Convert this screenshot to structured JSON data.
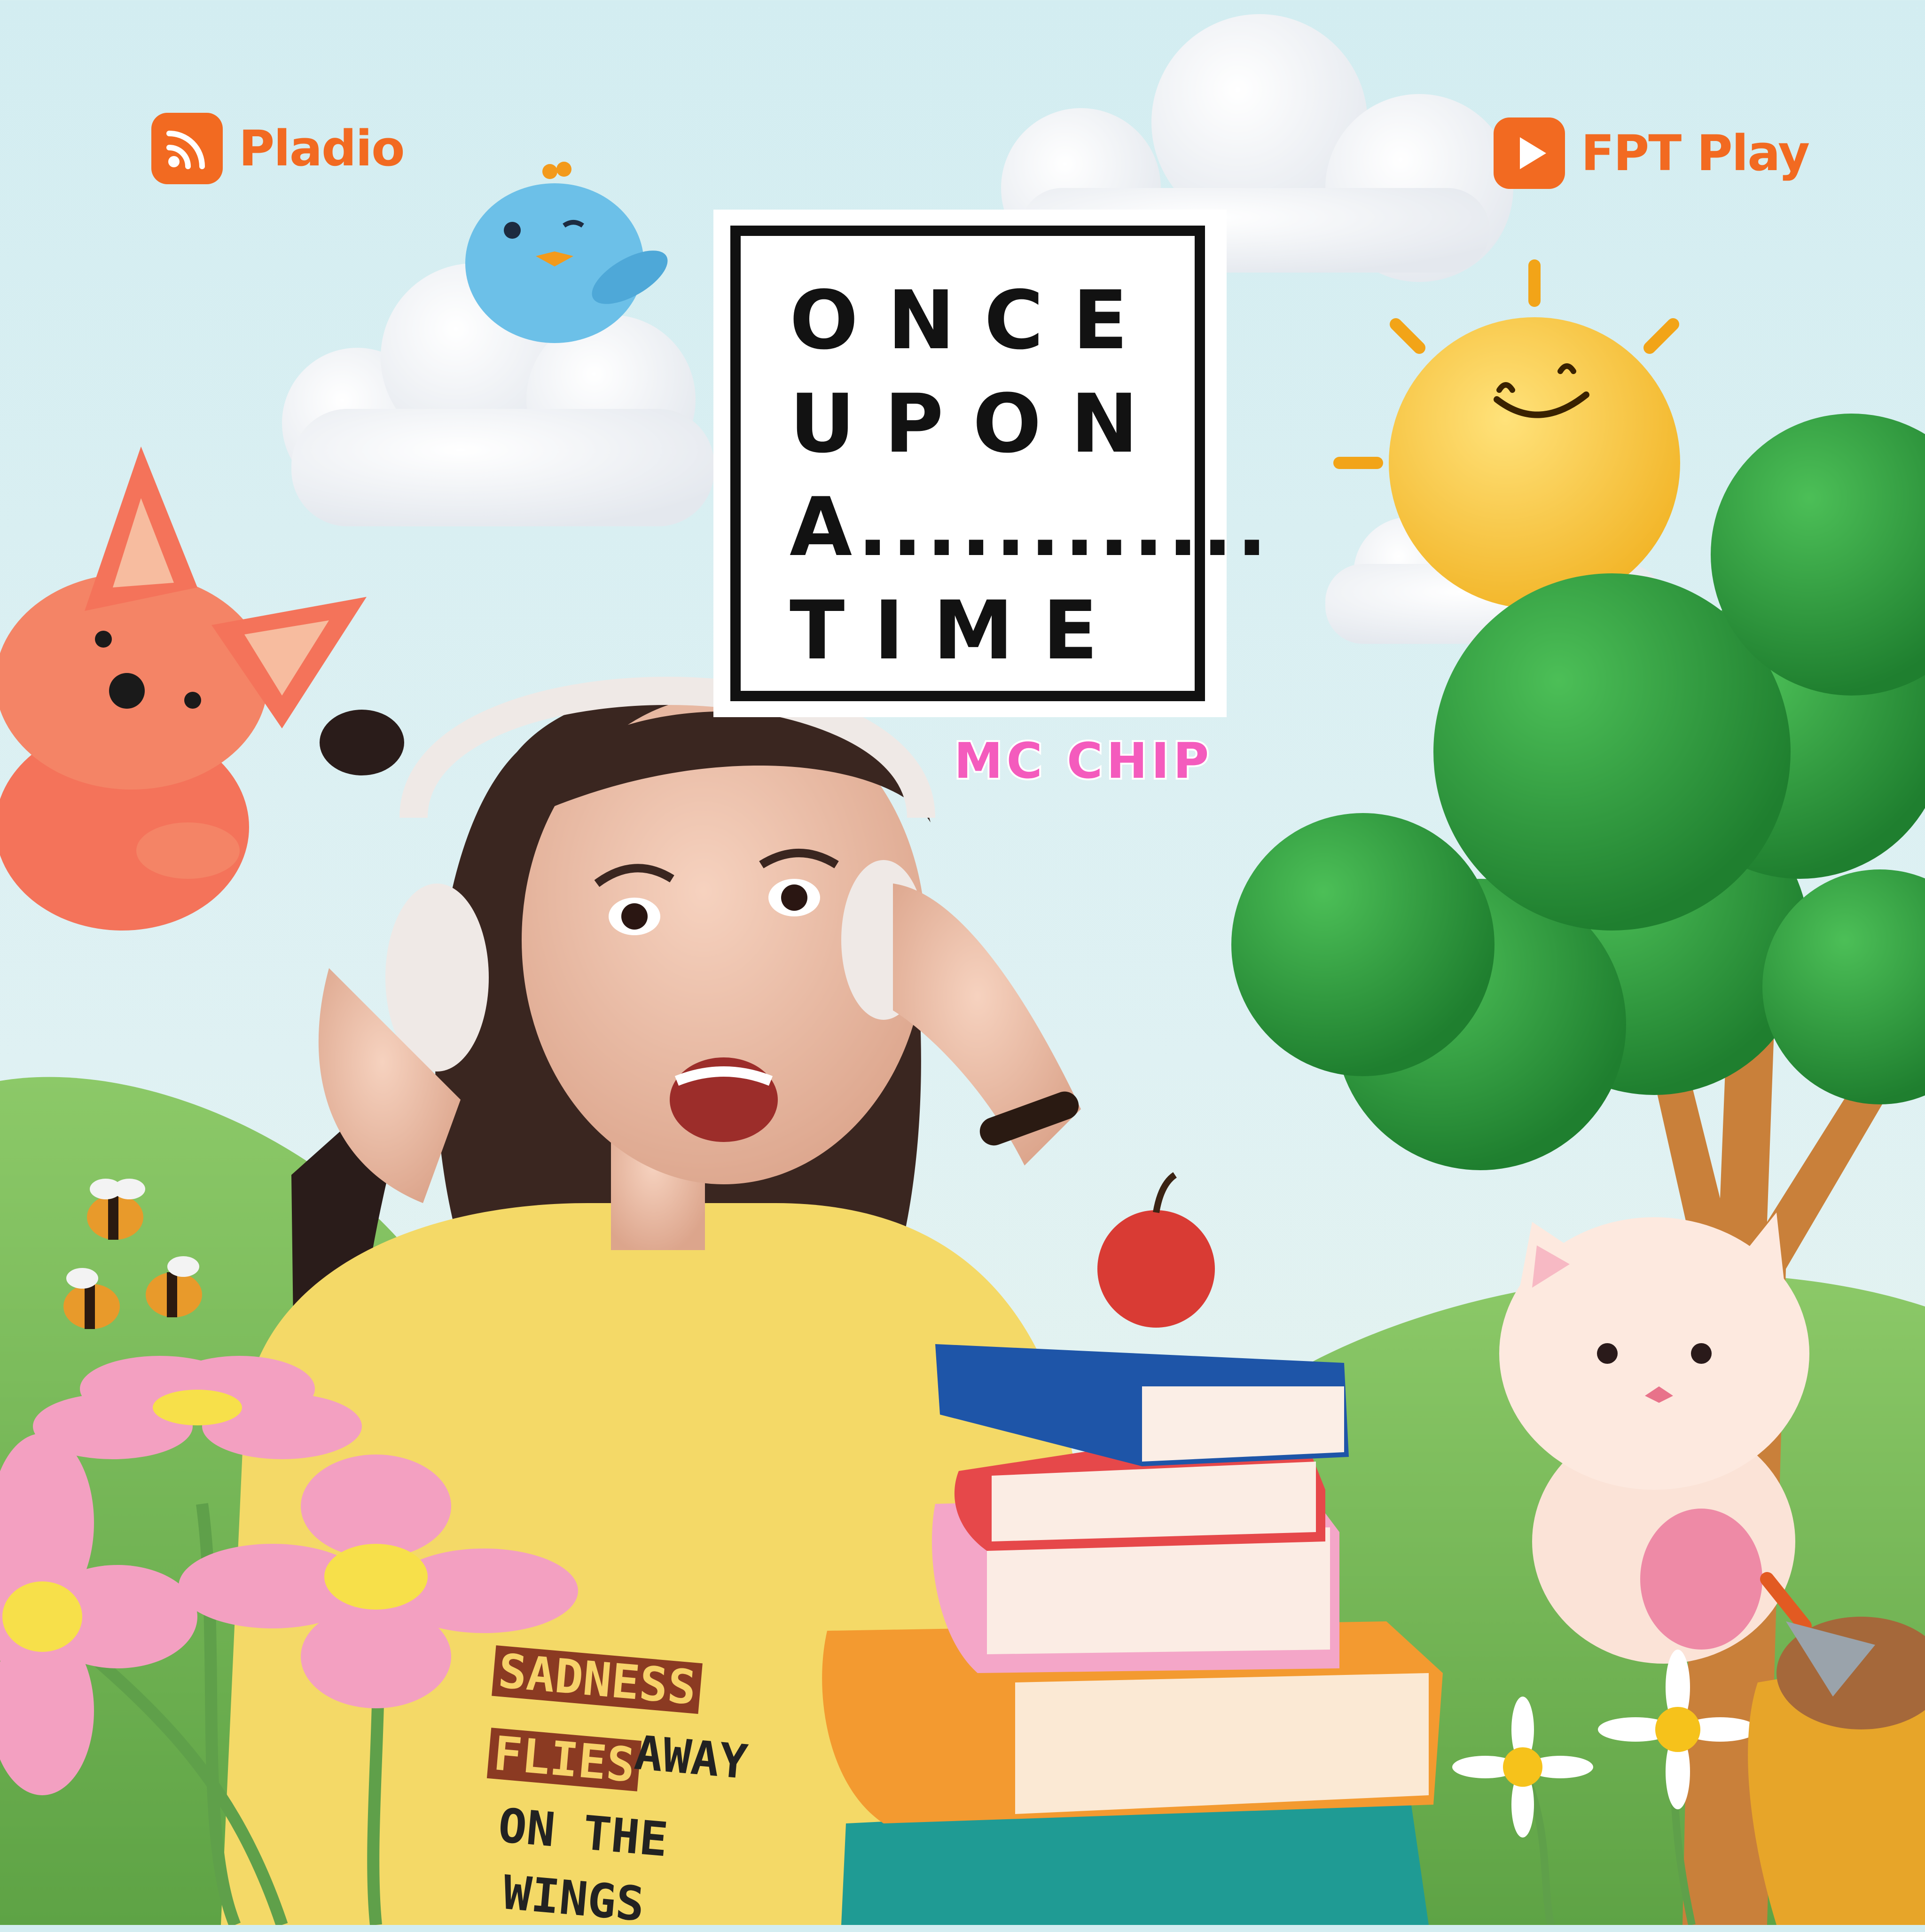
{
  "brands": {
    "left": "Pladio",
    "right": "FPT Play"
  },
  "title": {
    "line1": "ONCE",
    "line2": "UPON",
    "line3": "A............",
    "line4": "TIME"
  },
  "host": "MC CHIP",
  "shirt": {
    "w1": "SADNESS",
    "w2": "FLIES",
    "w3": "AWAY",
    "w4": "ON THE",
    "w5": "WINGS"
  },
  "colors": {
    "brand_orange": "#f26a21",
    "mc_pink": "#f45bbd",
    "sky": "#d3edf1",
    "grass": "#7fbd5a",
    "tree_green": "#2f9b3f",
    "shirt_yellow": "#f4d967"
  }
}
